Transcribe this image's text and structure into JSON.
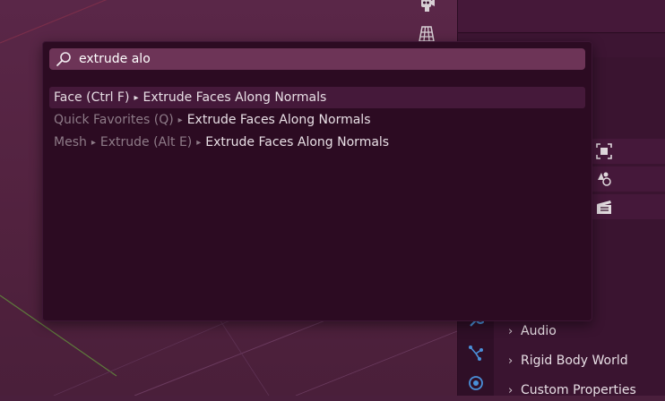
{
  "search": {
    "query": "extrude alo"
  },
  "results": [
    {
      "path": [
        "Face (Ctrl F)"
      ],
      "name": "Extrude Faces Along Normals",
      "active": true
    },
    {
      "path": [
        "Quick Favorites (Q)"
      ],
      "name": "Extrude Faces Along Normals",
      "active": false
    },
    {
      "path": [
        "Mesh",
        "Extrude (Alt E)"
      ],
      "name": "Extrude Faces Along Normals",
      "active": false
    }
  ],
  "properties": {
    "sections": [
      "Audio",
      "Rigid Body World",
      "Custom Properties"
    ]
  },
  "icons": {
    "search": "search-icon",
    "camera": "camera-icon",
    "grid": "grid-icon",
    "chevron": "chevron-right-icon"
  },
  "colors": {
    "popup_bg": "#2c0b22",
    "search_field": "#6d3457",
    "active_row": "#45193a",
    "text": "#e8dfe5",
    "path_text": "#8e7b88",
    "accent_tab": "#4a90d9"
  }
}
